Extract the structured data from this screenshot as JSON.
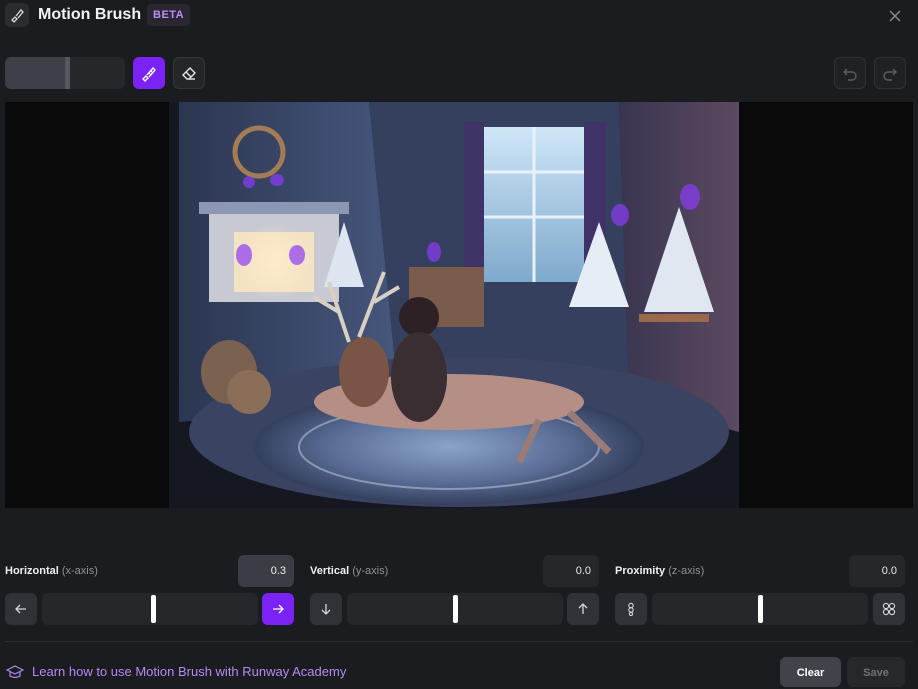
{
  "header": {
    "title": "Motion Brush",
    "badge": "BETA"
  },
  "controls": {
    "horizontal": {
      "label": "Horizontal",
      "axis": "(x-axis)",
      "value": "0.3"
    },
    "vertical": {
      "label": "Vertical",
      "axis": "(y-axis)",
      "value": "0.0"
    },
    "proximity": {
      "label": "Proximity",
      "axis": "(z-axis)",
      "value": "0.0"
    }
  },
  "footer": {
    "learn_link": "Learn how to use Motion Brush with Runway Academy",
    "clear_label": "Clear",
    "save_label": "Save"
  },
  "colors": {
    "accent": "#7b23f5",
    "background": "#1b1c1f",
    "link": "#b08cf2"
  },
  "brush_size_fraction": 0.5
}
